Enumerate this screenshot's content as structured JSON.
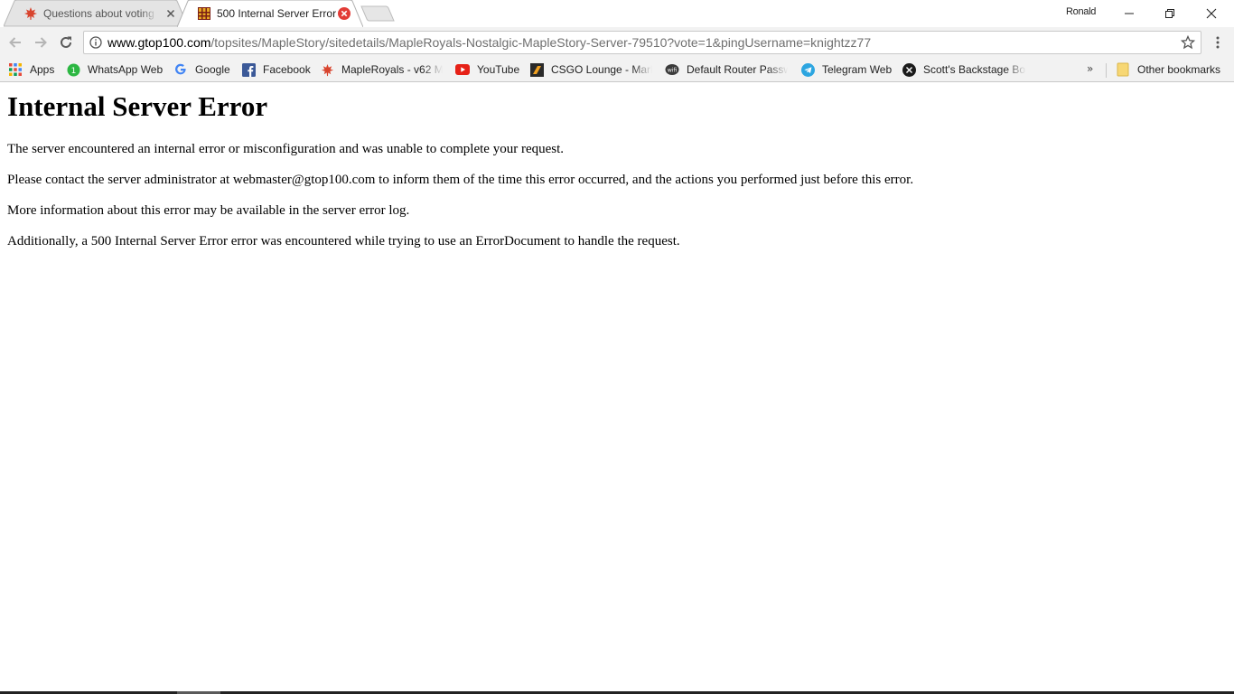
{
  "tabs": [
    {
      "title": "Questions about voting on",
      "favicon": "maple-leaf-icon",
      "active": false
    },
    {
      "title": "500 Internal Server Error",
      "favicon": "gtop100-icon",
      "active": true
    }
  ],
  "window": {
    "profile_name": "Ronald"
  },
  "address_bar": {
    "host": "www.gtop100.com",
    "path": "/topsites/MapleStory/sitedetails/MapleRoyals-Nostalgic-MapleStory-Server-79510?vote=1&pingUsername=knightzz77"
  },
  "bookmarks": {
    "items": [
      {
        "label": "Apps",
        "icon": "apps-grid-icon"
      },
      {
        "label": "WhatsApp Web",
        "icon": "whatsapp-icon"
      },
      {
        "label": "Google",
        "icon": "google-icon"
      },
      {
        "label": "Facebook",
        "icon": "facebook-icon"
      },
      {
        "label": "MapleRoyals - v62 M",
        "icon": "maple-leaf-icon"
      },
      {
        "label": "YouTube",
        "icon": "youtube-icon"
      },
      {
        "label": "CSGO Lounge - Mark",
        "icon": "csgo-lounge-icon"
      },
      {
        "label": "Default Router Passw",
        "icon": "router-icon"
      },
      {
        "label": "Telegram Web",
        "icon": "telegram-icon"
      },
      {
        "label": "Scott's Backstage Bor",
        "icon": "scotts-icon"
      }
    ],
    "overflow": "»",
    "other_bookmarks": "Other bookmarks"
  },
  "page": {
    "heading": "Internal Server Error",
    "paragraphs": [
      "The server encountered an internal error or misconfiguration and was unable to complete your request.",
      "Please contact the server administrator at webmaster@gtop100.com to inform them of the time this error occurred, and the actions you performed just before this error.",
      "More information about this error may be available in the server error log.",
      "Additionally, a 500 Internal Server Error error was encountered while trying to use an ErrorDocument to handle the request."
    ]
  },
  "colors": {
    "tab_active_bg": "#ffffff",
    "tab_inactive_bg": "#e4e4e4",
    "toolbar_bg": "#f2f2f2",
    "favicon_red": "#d83b2b",
    "error_close_red": "#e23b36"
  }
}
